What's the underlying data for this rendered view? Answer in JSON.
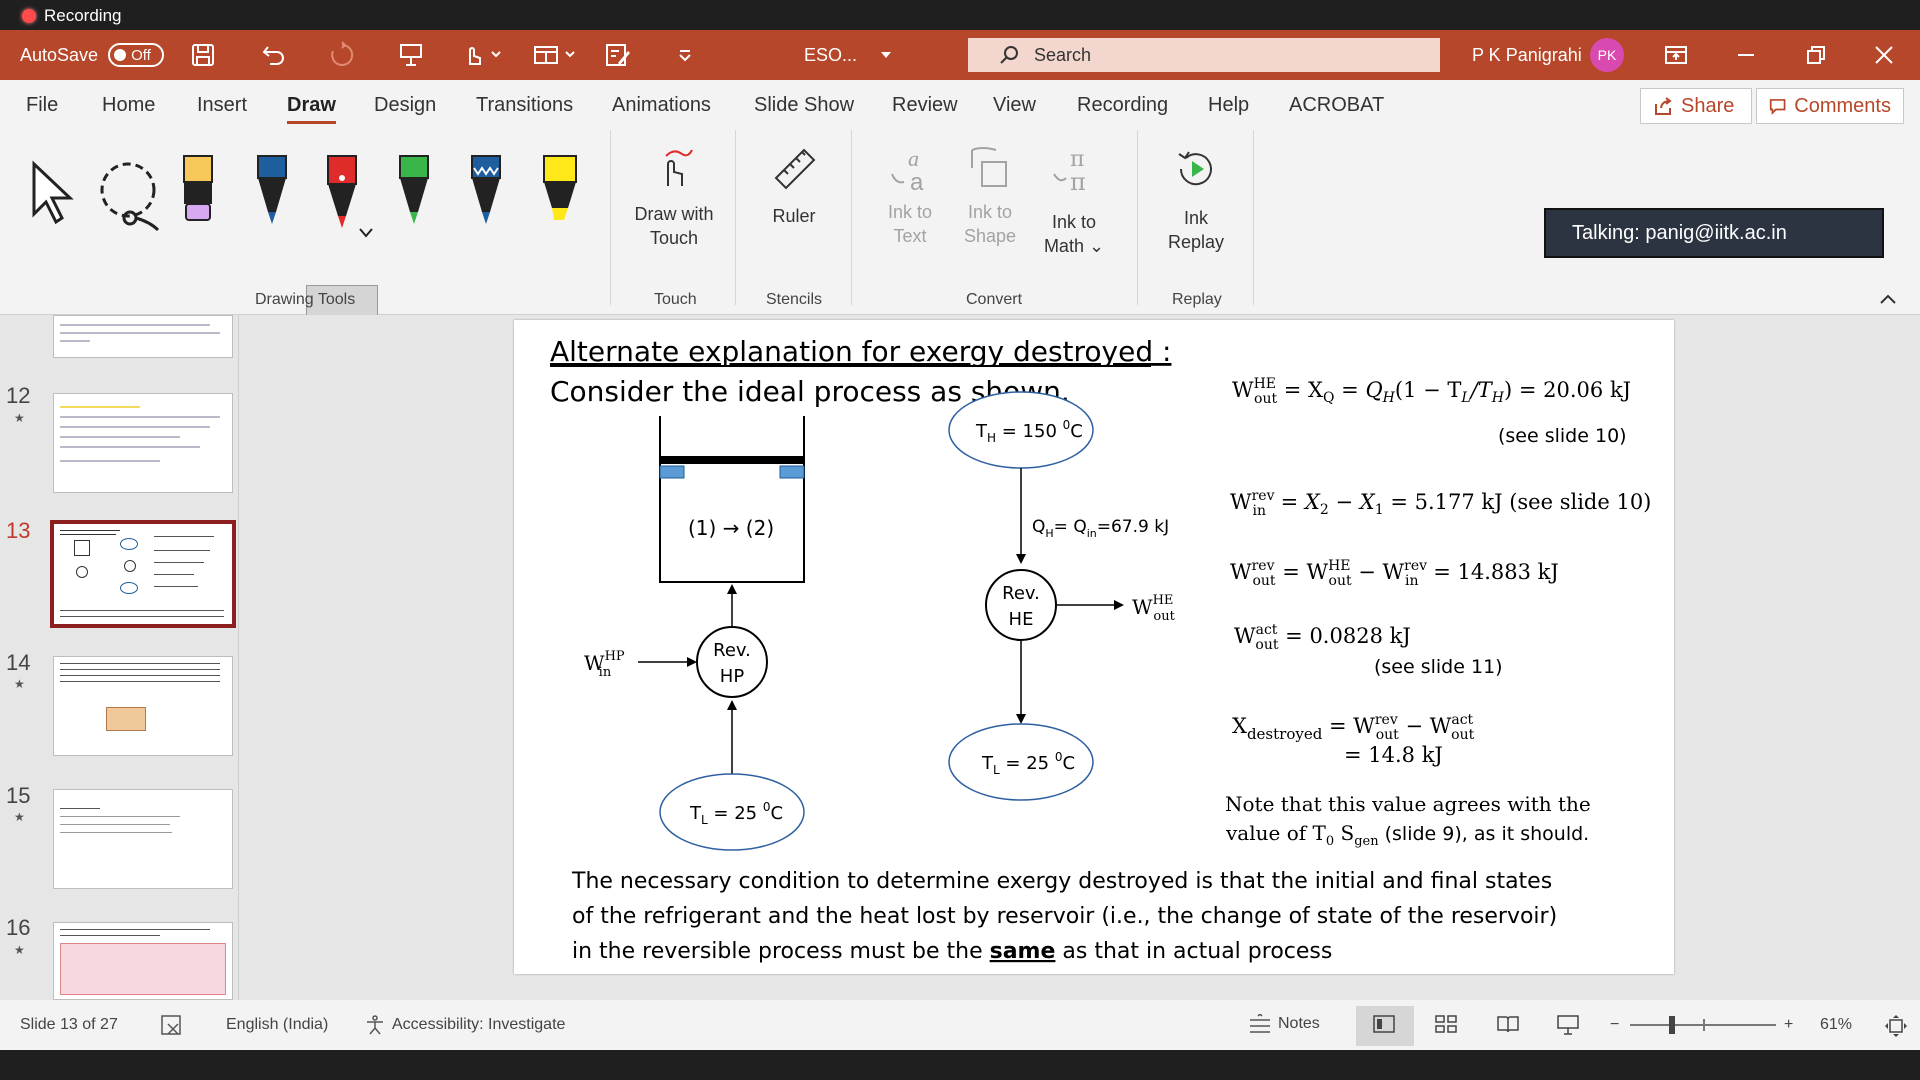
{
  "recording_indicator": "Recording",
  "titlebar": {
    "autosave_label": "AutoSave",
    "autosave_state": "Off",
    "filename": "ESO...",
    "search_placeholder": "Search",
    "user_name": "P K Panigrahi",
    "user_initials": "PK"
  },
  "menu": {
    "tabs": [
      "File",
      "Home",
      "Insert",
      "Draw",
      "Design",
      "Transitions",
      "Animations",
      "Slide Show",
      "Review",
      "View",
      "Recording",
      "Help",
      "ACROBAT"
    ],
    "active": "Draw",
    "share_label": "Share",
    "comments_label": "Comments"
  },
  "ribbon": {
    "groups": [
      "Drawing Tools",
      "Touch",
      "Stencils",
      "Convert",
      "Replay"
    ],
    "draw_with_touch": [
      "Draw with",
      "Touch"
    ],
    "ruler": "Ruler",
    "ink_to_text": [
      "Ink to",
      "Text"
    ],
    "ink_to_shape": [
      "Ink to",
      "Shape"
    ],
    "ink_to_math": [
      "Ink to",
      "Math ⌄"
    ],
    "ink_replay": [
      "Ink",
      "Replay"
    ],
    "pen_colors": [
      "#f6c95a",
      "#1f5e9e",
      "#e02b2b",
      "#39b54a",
      "#1f5e9e",
      "#ffe81a"
    ]
  },
  "tooltip": "Talking: panig@iitk.ac.in",
  "slides": {
    "numbers": [
      "12",
      "13",
      "14",
      "15",
      "16"
    ],
    "selected": "13"
  },
  "slide": {
    "heading": "Alternate explanation for exergy destroyed :",
    "subheading": "Consider the ideal process as shown.",
    "piston_state": "(1) → (2)",
    "th": "T",
    "th_sub": "H",
    "th_val": " = 150 ",
    "deg": "0",
    "celsius": "C",
    "qh": "Q",
    "qh_sub": "H",
    "qin_eq": "= Q",
    "qin_sub": "in",
    "qin_val": "=67.9 kJ",
    "rev_he": [
      "Rev.",
      "HE"
    ],
    "rev_hp": [
      "Rev.",
      "HP"
    ],
    "w": "W",
    "he_sup": "HE",
    "out_sub": "out",
    "hp_sup": "HP",
    "in_sub": "in",
    "tl": "T",
    "tl_sub": "L",
    "tl_val": " = 25 ",
    "eq1_w": "W",
    "eq1_he": "HE",
    "eq1_out": "out",
    "eq1_mid": " = X",
    "eq1_q": "Q",
    "eq1_qh": " = Q",
    "eq1_h": "H",
    "eq1_paren": "(1 − T",
    "eq1_l": "L",
    "eq1_slash": "/T",
    "eq1_h2": "H",
    "eq1_end": ") = 20.06 kJ",
    "eq1_note": "(see slide 10)",
    "eq2_w": "W",
    "eq2_rev": "rev",
    "eq2_in": "in",
    "eq2_mid": " = X",
    "eq2_2": "2",
    "eq2_minus": " − X",
    "eq2_1": "1",
    "eq2_end": " = 5.177 kJ  (see slide 10)",
    "eq3_w": "W",
    "eq3_rev": "rev",
    "eq3_out": "out",
    "eq3_mid": " = W",
    "eq3_he": "HE",
    "eq3_out2": "out",
    "eq3_minus": " − W",
    "eq3_rev2": "rev",
    "eq3_in": "in",
    "eq3_end": " = 14.883 kJ",
    "eq4_w": "W",
    "eq4_act": "act",
    "eq4_out": "out",
    "eq4_end": " = 0.0828 kJ",
    "eq4_note": "(see slide 11)",
    "eq5_x": "X",
    "eq5_sub": "destroyed",
    "eq5_mid": " = W",
    "eq5_rev": "rev",
    "eq5_out": "out",
    "eq5_minus": " − W",
    "eq5_act": "act",
    "eq5_out2": "out",
    "eq5_line2": "= 14.8 kJ",
    "note1": "Note that this value agrees with the",
    "note2a": "value of  T",
    "note2_0": "0",
    "note2b": " S",
    "note2_gen": "gen",
    "note2c": " (slide 9), as it should.",
    "para1": "The necessary condition to determine exergy destroyed is that the initial and final states",
    "para2": "of the refrigerant and the heat lost by reservoir (i.e., the change of state of the reservoir)",
    "para3a": "in the reversible process must be the ",
    "para3_bold": "same",
    "para3b": "  as that in actual process"
  },
  "status": {
    "slide_info": "Slide 13 of 27",
    "language": "English (India)",
    "accessibility": "Accessibility: Investigate",
    "notes": "Notes",
    "zoom_minus": "−",
    "zoom_plus": "+",
    "zoom": "61%"
  }
}
